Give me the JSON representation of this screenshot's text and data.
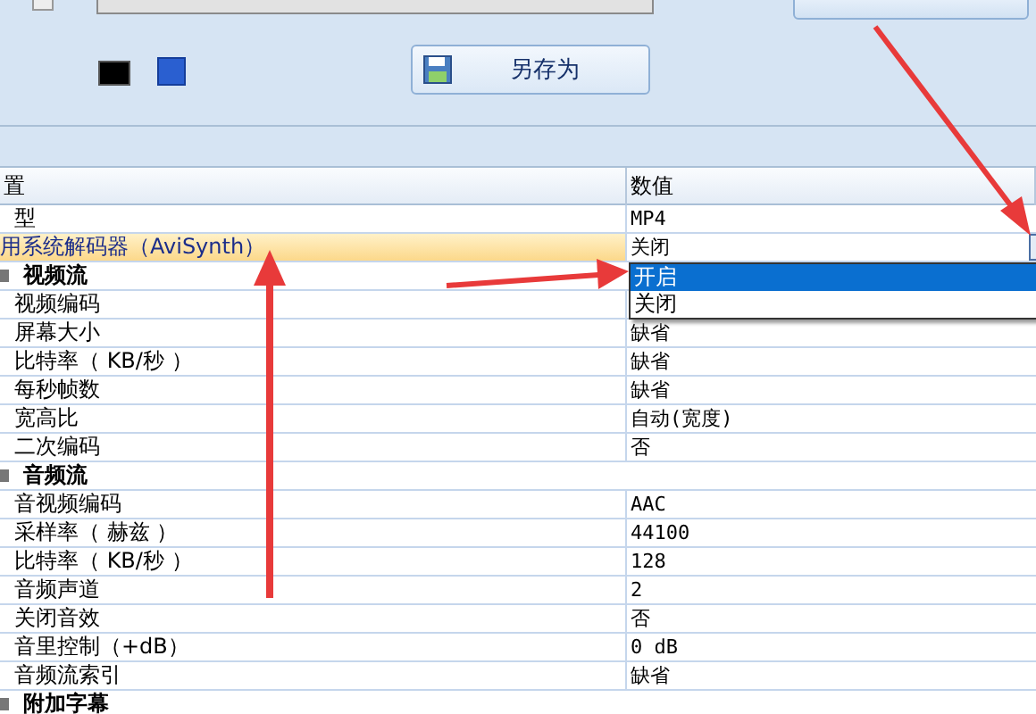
{
  "toolbar": {
    "save_as_button": "另存为"
  },
  "table": {
    "columns": [
      "置",
      "数值"
    ],
    "rows": [
      {
        "kind": "item",
        "name": "型",
        "value": "MP4",
        "selected": false
      },
      {
        "kind": "item",
        "name": "用系统解码器（AviSynth）",
        "value": "关闭",
        "selected": true
      },
      {
        "kind": "group",
        "name": "视频流"
      },
      {
        "kind": "item",
        "name": "视频编码",
        "selected": false
      },
      {
        "kind": "item",
        "name": "屏幕大小",
        "value": "缺省",
        "selected": false
      },
      {
        "kind": "item",
        "name": "比特率（ KB/秒 ）",
        "value": "缺省",
        "selected": false
      },
      {
        "kind": "item",
        "name": "每秒帧数",
        "value": "缺省",
        "selected": false
      },
      {
        "kind": "item",
        "name": "宽高比",
        "value": "自动(宽度)",
        "selected": false
      },
      {
        "kind": "item",
        "name": "二次编码",
        "value": "否",
        "selected": false
      },
      {
        "kind": "group",
        "name": "音频流"
      },
      {
        "kind": "item",
        "name": "音视频编码",
        "value": "AAC",
        "selected": false
      },
      {
        "kind": "item",
        "name": "采样率（ 赫兹 ）",
        "value": "44100",
        "selected": false
      },
      {
        "kind": "item",
        "name": "比特率（ KB/秒 ）",
        "value": "128",
        "selected": false
      },
      {
        "kind": "item",
        "name": "音频声道",
        "value": "2",
        "selected": false
      },
      {
        "kind": "item",
        "name": "关闭音效",
        "value": "否",
        "selected": false
      },
      {
        "kind": "item",
        "name": "音里控制（+dB）",
        "value": "0 dB",
        "selected": false
      },
      {
        "kind": "item",
        "name": "音频流索引",
        "value": "缺省",
        "selected": false
      },
      {
        "kind": "group",
        "name": "附加字幕"
      }
    ]
  },
  "dropdown": {
    "options": [
      {
        "label": "开启",
        "selected": true
      },
      {
        "label": "关闭",
        "selected": false
      }
    ]
  }
}
